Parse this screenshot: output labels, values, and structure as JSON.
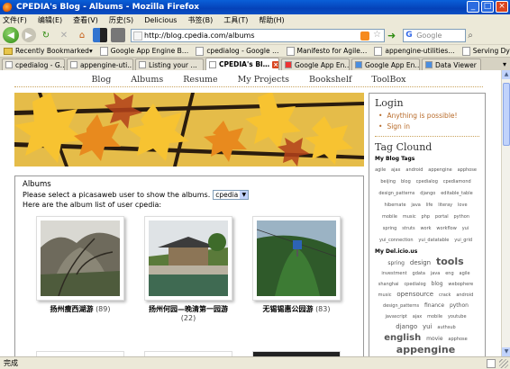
{
  "window": {
    "title": "CPEDIA's Blog - Albums - Mozilla Firefox",
    "buttons": [
      "_",
      "□",
      "×"
    ]
  },
  "menu": [
    "文件(F)",
    "编辑(E)",
    "查看(V)",
    "历史(S)",
    "Delicious",
    "书签(B)",
    "工具(T)",
    "帮助(H)"
  ],
  "toolbar": {
    "url": "http://blog.cpedia.com/albums",
    "search_placeholder": "Google",
    "search_engine": "G"
  },
  "bookmarks": [
    {
      "label": "Recently Bookmarked",
      "type": "folder"
    },
    {
      "label": "Google App Engine B…",
      "type": "page"
    },
    {
      "label": "cpedialog - Google …",
      "type": "page"
    },
    {
      "label": "Manifesto for Agile…",
      "type": "page"
    },
    {
      "label": "appengine-utilities…",
      "type": "page"
    },
    {
      "label": "Serving Dynamic Ima…",
      "type": "page"
    }
  ],
  "tabs": [
    {
      "label": "cpedialog - G…",
      "active": false
    },
    {
      "label": "appengine-uti…",
      "active": false
    },
    {
      "label": "Listing your …",
      "active": false
    },
    {
      "label": "CPEDIA's Bl…",
      "active": true
    },
    {
      "label": "Google App En…",
      "active": false
    },
    {
      "label": "Google App En…",
      "active": false
    },
    {
      "label": "Data Viewer",
      "active": false
    }
  ],
  "site_nav": [
    "Blog",
    "Albums",
    "Resume",
    "My Projects",
    "Bookshelf",
    "ToolBox"
  ],
  "albums_panel": {
    "heading": "Albums",
    "prompt": "Please select a picasaweb user to show the albums.",
    "selected_user": "cpedia",
    "list_label": "Here are the album list of user cpedia:",
    "albums": [
      {
        "name": "扬州瘦西湖游",
        "count": "(89)"
      },
      {
        "name": "扬州何园—晚清第一园游",
        "count": "(22)"
      },
      {
        "name": "无锡锡惠公园游",
        "count": "(83)"
      }
    ]
  },
  "sidebar": {
    "login_title": "Login",
    "login_items": [
      "Anything is possible!",
      "Sign in"
    ],
    "tag_title": "Tag Clound",
    "blog_tags_title": "My Blog Tags",
    "blog_tags": [
      "agile",
      "ajax",
      "android",
      "appengine",
      "apphose",
      "beijing",
      "blog",
      "cpedialog",
      "cpediamond",
      "design_patterns",
      "django",
      "editable_table",
      "hibernate",
      "java",
      "life",
      "literay",
      "love",
      "mobile",
      "music",
      "php",
      "portal",
      "python",
      "spring",
      "struts",
      "work",
      "workflow",
      "yui",
      "yui_connection",
      "yui_datatable",
      "yui_grid"
    ],
    "delicious_title": "My Del.icio.us",
    "delicious_tags": [
      {
        "t": "spring",
        "s": 6
      },
      {
        "t": "design",
        "s": 7
      },
      {
        "t": "tools",
        "s": 11
      },
      {
        "t": "investment",
        "s": 5
      },
      {
        "t": "gdata",
        "s": 5
      },
      {
        "t": "java",
        "s": 5
      },
      {
        "t": "eng",
        "s": 5
      },
      {
        "t": "agile",
        "s": 5
      },
      {
        "t": "shanghai",
        "s": 5
      },
      {
        "t": "cpedialog",
        "s": 5
      },
      {
        "t": "blog",
        "s": 6
      },
      {
        "t": "webophere",
        "s": 5
      },
      {
        "t": "music",
        "s": 5
      },
      {
        "t": "opensource",
        "s": 7
      },
      {
        "t": "crack",
        "s": 5
      },
      {
        "t": "android",
        "s": 5
      },
      {
        "t": "design_patterns",
        "s": 5
      },
      {
        "t": "finance",
        "s": 6
      },
      {
        "t": "python",
        "s": 6
      },
      {
        "t": "javascript",
        "s": 5
      },
      {
        "t": "ajax",
        "s": 5
      },
      {
        "t": "mobile",
        "s": 5
      },
      {
        "t": "youtube",
        "s": 5
      },
      {
        "t": "django",
        "s": 7
      },
      {
        "t": "yui",
        "s": 7
      },
      {
        "t": "authsub",
        "s": 5
      },
      {
        "t": "english",
        "s": 10
      },
      {
        "t": "movie",
        "s": 6
      },
      {
        "t": "apphose",
        "s": 5
      },
      {
        "t": "appengine",
        "s": 11
      }
    ]
  },
  "status": "完成"
}
